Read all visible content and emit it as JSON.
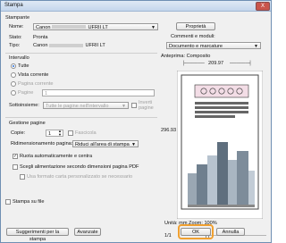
{
  "window": {
    "title": "Stampa",
    "close": "X"
  },
  "printer": {
    "section": "Stampante",
    "name_label": "Nome:",
    "name_value": "Canon",
    "name_suffix": "UFRII LT",
    "properties_button": "Proprietà",
    "state_label": "Stato:",
    "state_value": "Pronta",
    "type_label": "Tipo:",
    "type_value": "Canon",
    "type_suffix": "UFRII LT",
    "comments_label": "Commenti e moduli:",
    "comments_value": "Documento e marcature"
  },
  "range": {
    "section": "Intervallo",
    "all": "Tutte",
    "current_view": "Vista corrente",
    "current_page": "Pagina corrente",
    "pages": "Pagine",
    "pages_value": "1",
    "subset_label": "Sottoinsieme:",
    "subset_value": "Tutte le pagine nell'intervallo",
    "reverse": "Inverti pagine"
  },
  "handling": {
    "section": "Gestione pagine",
    "copies_label": "Copie:",
    "copies_value": "1",
    "collate": "Fascicola",
    "scaling_label": "Ridimensionamento pagina:",
    "scaling_value": "Riduci all'area di stampa",
    "autorotate": "Ruota automaticamente e centra",
    "choose_source": "Scegli alimentazione secondo dimensioni pagina PDF",
    "custom_size": "Usa formato carta personalizzato se necessario"
  },
  "print_to_file": "Stampa su file",
  "preview": {
    "label": "Anteprima: Composito",
    "width": "209.97",
    "height": "296.93",
    "units": "Unità: mm Zoom: 100%",
    "page_counter": "1/1"
  },
  "footer": {
    "tips_button": "Suggerimenti per la stampa",
    "advanced_button": "Avanzate",
    "ok_button": "OK",
    "cancel_button": "Annulla"
  },
  "colors": {
    "accent": "#f0a030",
    "selected": "#2b6fd6"
  }
}
